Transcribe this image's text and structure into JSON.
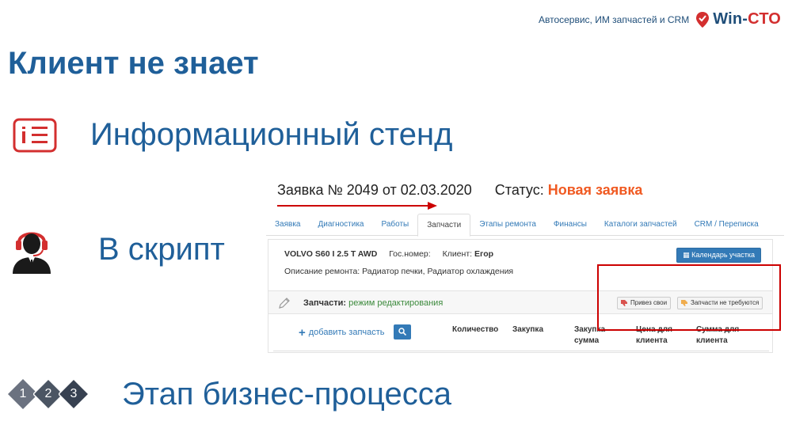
{
  "brand": {
    "tagline": "Автосервис, ИМ запчастей и CRM",
    "logo_main": "Win-",
    "logo_accent": "СТО",
    "logo_color": "#1f4e79",
    "logo_accent_color": "#d32f2f"
  },
  "slide": {
    "title": "Клиент не знает",
    "title_color": "#1f5f99"
  },
  "bullets": [
    {
      "icon": "info-stand-icon",
      "text": "Информационный стенд"
    },
    {
      "icon": "operator-headset-icon",
      "text": "В скрипт"
    },
    {
      "icon": "process-steps-icon",
      "text": "Этап бизнес-процесса",
      "steps": [
        "1",
        "2",
        "3"
      ]
    }
  ],
  "screenshot": {
    "order_title": "Заявка № 2049 от 02.03.2020",
    "status_label": "Статус:",
    "status_value": "Новая заявка",
    "status_color": "#f05a22",
    "tabs": [
      "Заявка",
      "Диагностика",
      "Работы",
      "Запчасти",
      "Этапы ремонта",
      "Финансы",
      "Каталоги запчастей",
      "CRM / Переписка"
    ],
    "active_tab": "Запчасти",
    "car": {
      "model": "VOLVO S60 I 2.5 T AWD",
      "plate_label": "Гос.номер:",
      "client_label": "Клиент:",
      "client_name": "Егор"
    },
    "calendar_button": "Календарь участка",
    "repair_description": "Описание ремонта: Радиатор печки, Радиатор охлаждения",
    "parts": {
      "title": "Запчасти:",
      "mode": "режим редактирования",
      "btn_own": "Привез свои",
      "btn_not_needed": "Запчасти не требуются",
      "add_part": "добавить запчасть",
      "columns": [
        "Количество",
        "Закупка",
        "Закупка сумма",
        "Цена для клиента",
        "Сумма для клиента"
      ]
    }
  },
  "colors": {
    "primary_blue": "#337ab7",
    "highlight_red": "#cc0000",
    "diamond_gray": "#6b7280"
  }
}
